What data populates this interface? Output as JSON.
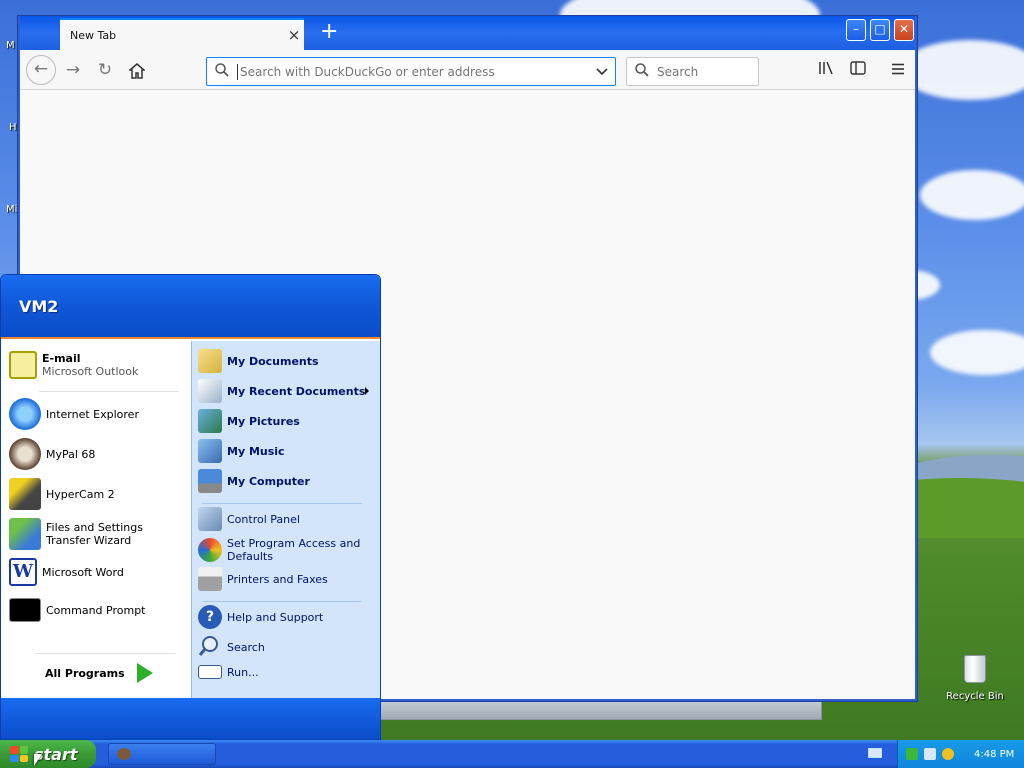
{
  "desktop": {
    "left_labels": [
      "M",
      "H",
      "Mi"
    ],
    "recycle_bin_label": "Recycle Bin"
  },
  "browser": {
    "tab_title": "New Tab",
    "tab_close": "×",
    "new_tab": "+",
    "url_placeholder": "Search with DuckDuckGo or enter address",
    "search_placeholder": "Search",
    "window_buttons": {
      "minimize": "–",
      "maximize": "□",
      "close": "✕"
    }
  },
  "start_menu": {
    "username": "VM2",
    "pinned": [
      {
        "title": "E-mail",
        "subtitle": "Microsoft Outlook"
      }
    ],
    "programs": [
      "Internet Explorer",
      "MyPal 68",
      "HyperCam 2",
      "Files and Settings Transfer Wizard",
      "Microsoft Word",
      "Command Prompt"
    ],
    "all_programs": "All Programs",
    "places": [
      "My Documents",
      "My Recent Documents",
      "My Pictures",
      "My Music",
      "My Computer"
    ],
    "settings": [
      "Control Panel",
      "Set Program Access and Defaults",
      "Printers and Faxes"
    ],
    "tools": [
      "Help and Support",
      "Search",
      "Run..."
    ]
  },
  "taskbar": {
    "start_label": "start",
    "clock": "4:48 PM"
  },
  "colors": {
    "xp_blue": "#245edc",
    "start_green": "#3a9a36",
    "accent_orange": "#f08a2a",
    "firefox_focus": "#0a84ff"
  }
}
